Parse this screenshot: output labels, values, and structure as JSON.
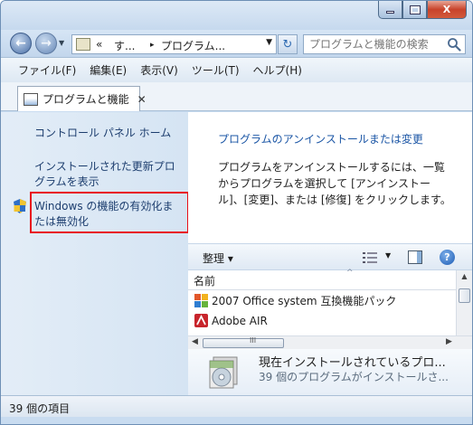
{
  "titlebar": {
    "minimize_glyph": "",
    "maximize_glyph": "",
    "close_glyph": "X"
  },
  "navigation": {
    "back_glyph": "←",
    "forward_glyph": "→",
    "breadcrumb": {
      "overflow": "«",
      "segment1": "す...",
      "separator": "▸",
      "segment2": "プログラム..."
    },
    "refresh_glyph": "↻",
    "search_placeholder": "プログラムと機能の検索"
  },
  "menu": [
    "ファイル(F)",
    "編集(E)",
    "表示(V)",
    "ツール(T)",
    "ヘルプ(H)"
  ],
  "tab": {
    "label": "プログラムと機能",
    "close_glyph": "✕"
  },
  "sidebar": {
    "links": [
      "コントロール パネル ホーム",
      "インストールされた更新プログラムを表示",
      "Windows の機能の有効化または無効化"
    ],
    "highlighted_index": 2
  },
  "main": {
    "title": "プログラムのアンインストールまたは変更",
    "description": "プログラムをアンインストールするには、一覧からプログラムを選択して [アンインストール]、[変更]、または [修復] をクリックします。"
  },
  "toolbar": {
    "organize_label": "整理 ▾",
    "help_glyph": "?"
  },
  "list": {
    "column_header": "名前",
    "sort_glyph": "^",
    "items": [
      {
        "name": "2007 Office system 互換機能パック",
        "icon": "office-icon"
      },
      {
        "name": "Adobe AIR",
        "icon": "adobe-air-icon"
      }
    ]
  },
  "scrollbar": {
    "grip": "III"
  },
  "details": {
    "line1": "現在インストールされているプロ...",
    "line2": "39 個のプログラムがインストールさ..."
  },
  "status": {
    "text": "39 個の項目"
  },
  "colors": {
    "highlight_border": "#e8101a",
    "link": "#1c3d6e",
    "title_link": "#1a55a5"
  }
}
